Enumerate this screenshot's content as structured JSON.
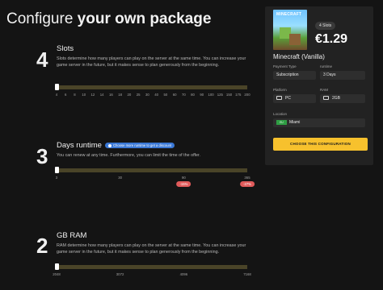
{
  "header": {
    "title_plain": "Configure ",
    "title_bold": "your own package"
  },
  "slots": {
    "number": "4",
    "heading": "Slots",
    "description": "Slots determine how many players can play on the server at the same time. You can increase your game server in the future, but it makes sense to plan generously from the beginning.",
    "ticks": [
      "4",
      "6",
      "8",
      "10",
      "12",
      "14",
      "16",
      "18",
      "20",
      "25",
      "30",
      "40",
      "50",
      "60",
      "70",
      "80",
      "90",
      "100",
      "125",
      "150",
      "175",
      "200"
    ],
    "selected_index": 0
  },
  "runtime": {
    "number": "3",
    "heading": "Days runtime",
    "badge": "Choose more runtime to get a discount",
    "description": "You can renew at any time. Furthermore, you can limit the time of the offer.",
    "ticks": [
      "3",
      "30",
      "90",
      "365"
    ],
    "discounts": [
      "-15%",
      "-27%"
    ],
    "selected_index": 0
  },
  "ram": {
    "number": "2",
    "heading": "GB RAM",
    "description": "RAM determine how many players can play on the server at the same time. You can increase your game server in the future, but it makes sense to plan generously from the beginning.",
    "ticks": [
      "2048",
      "3072",
      "4096",
      "7168"
    ],
    "selected_index": 0
  },
  "summary": {
    "logo_text": "MINECRAFT",
    "slots_badge": "4 Slots",
    "price": "€1.29",
    "game": "Minecraft (Vanilla)",
    "payment_label": "Payment Type",
    "payment_value": "Subscription",
    "runtime_label": "runtime",
    "runtime_value": "3 Days",
    "platform_label": "Platform",
    "platform_value": "PC",
    "ram_label": "RAM",
    "ram_value": "2GB",
    "location_label": "Location",
    "location_flag": "EU",
    "location_value": "Miami",
    "cta": "CHOOSE THIS CONFIGURATION"
  },
  "colors": {
    "accent": "#f7c12d",
    "discount": "#e05a5a",
    "badge": "#3a78d6",
    "track": "#4a4428"
  }
}
